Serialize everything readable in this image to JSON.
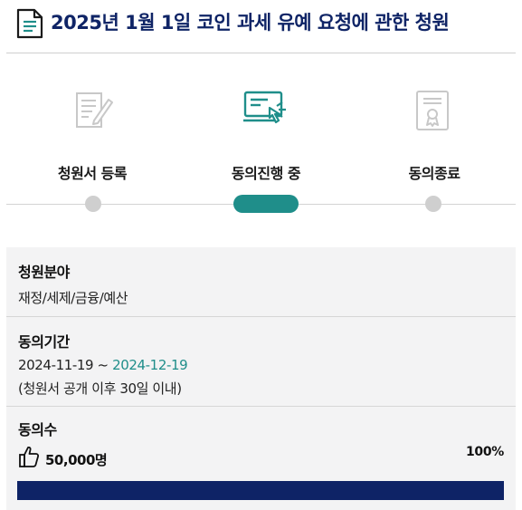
{
  "header": {
    "title": "2025년 1월 1일 코인 과세 유예 요청에 관한 청원",
    "icon": "document-icon"
  },
  "steps": [
    {
      "label": "청원서 등록",
      "icon": "write-document-icon",
      "state": "done"
    },
    {
      "label": "동의진행 중",
      "icon": "online-consent-icon",
      "state": "active"
    },
    {
      "label": "동의종료",
      "icon": "certificate-icon",
      "state": "pending"
    }
  ],
  "info": {
    "category": {
      "title": "청원분야",
      "value": "재정/세제/금융/예산"
    },
    "period": {
      "title": "동의기간",
      "start": "2024-11-19",
      "separator": " ~ ",
      "end": "2024-12-19",
      "note": "(청원서 공개 이후 30일 이내)"
    },
    "consent": {
      "title": "동의수",
      "count": "50,000명",
      "percent_label": "100%",
      "progress": 1.0
    }
  },
  "colors": {
    "accent": "#1f8e8a",
    "navy": "#0e2366",
    "inactive": "#cfcfcf"
  }
}
